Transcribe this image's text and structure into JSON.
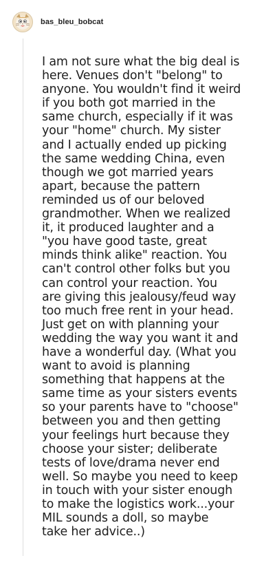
{
  "comment": {
    "username": "bas_bleu_bobcat",
    "avatar_icon": "bobcat-avatar-icon",
    "body_lines": [
      "I am not sure what the big deal is",
      "here. Venues don't \"belong\" to",
      "anyone. You wouldn't find it weird",
      "if you both got married in the",
      "same church, especially if it was",
      "your \"home\" church. My sister",
      "and I actually ended up picking",
      "the same wedding China, even",
      "though we got married years",
      "apart, because the pattern",
      "reminded us of our beloved",
      "grandmother. When we realized",
      "it, it produced laughter and a",
      "\"you have good taste, great",
      "minds think alike\" reaction. You",
      "can't control other folks but you",
      "can control your reaction. You",
      "are giving this jealousy/feud way",
      "too much free rent in your head.",
      "Just get on with planning your",
      "wedding the way you want it and",
      "have a wonderful day. (What you",
      "want to avoid is planning",
      "something that happens at the",
      "same time as your sisters events",
      "so your parents have to \"choose\"",
      "between you and then getting",
      "your feelings hurt because they",
      "choose your sister; deliberate",
      "tests of love/drama never end",
      "well. So maybe you need to keep",
      "in touch with your sister enough",
      "to make the logistics work...your",
      "MIL sounds a doll, so maybe",
      "take her advice..)"
    ]
  }
}
